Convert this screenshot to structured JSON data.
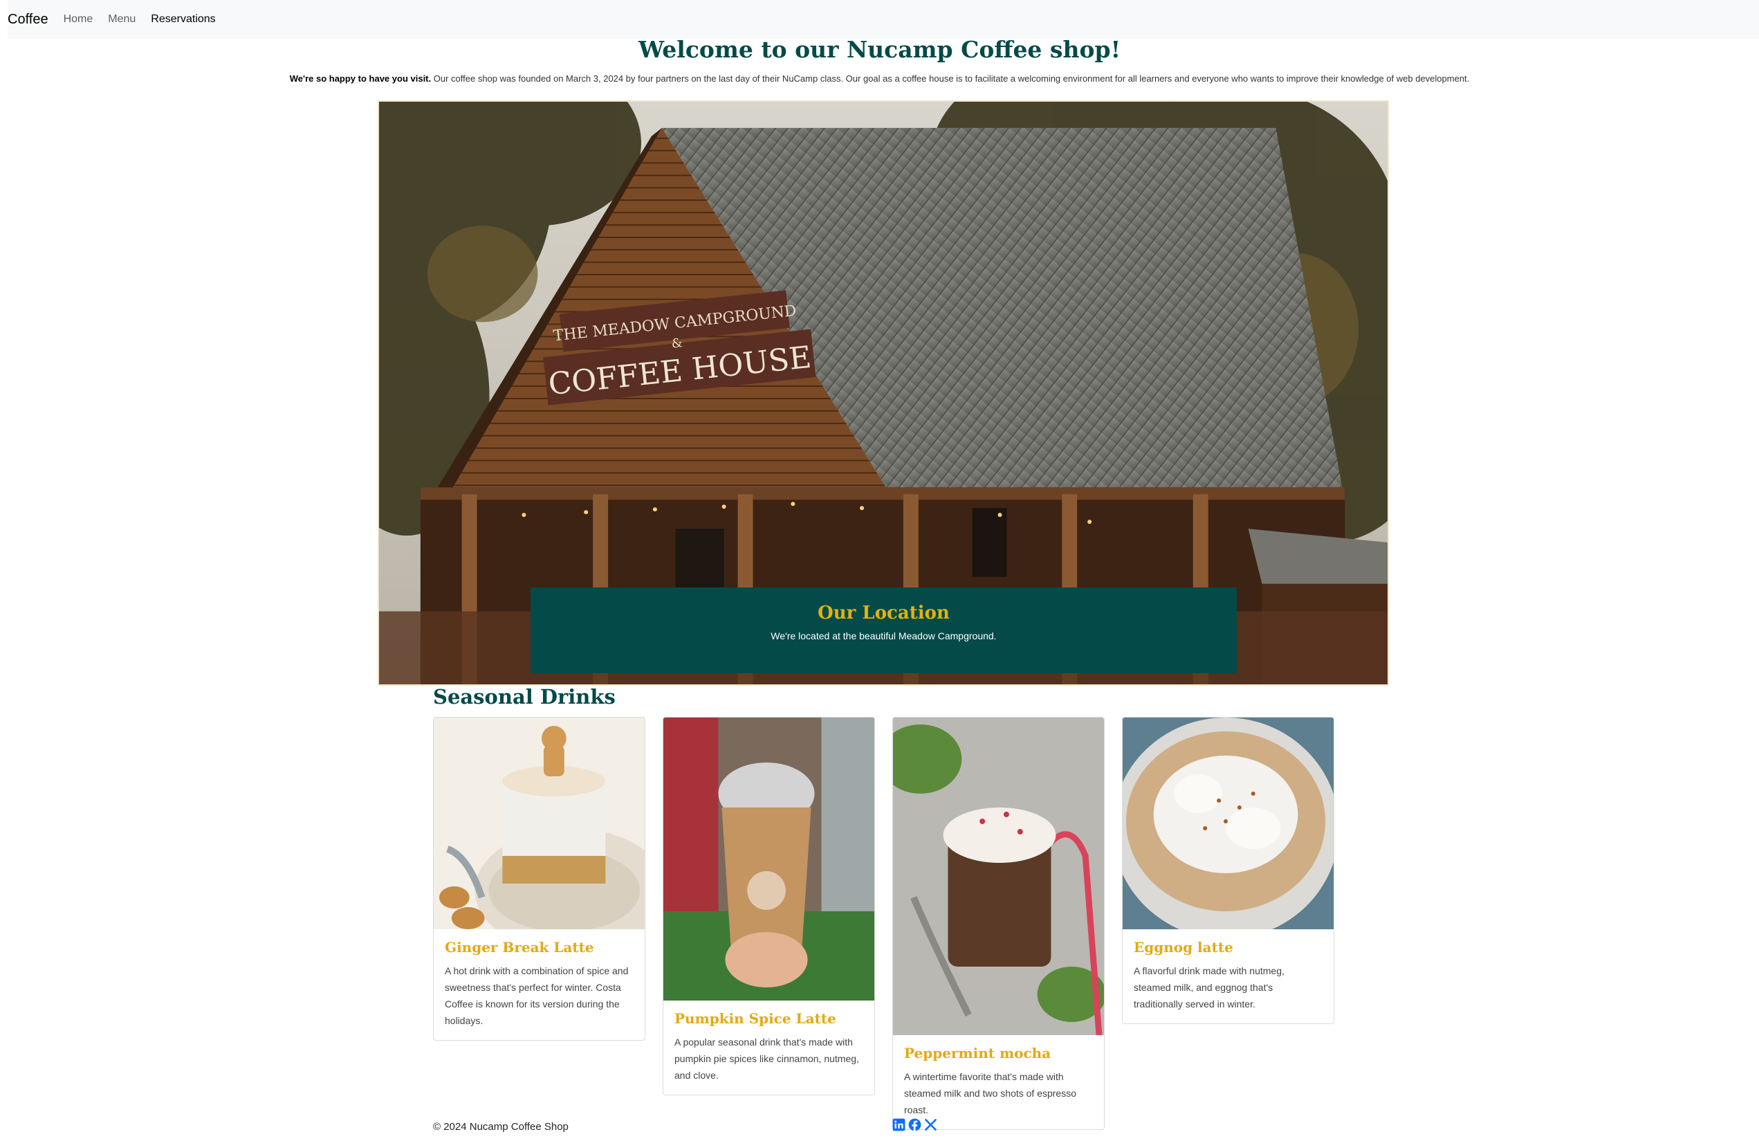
{
  "nav": {
    "brand": "Coffee",
    "links": [
      {
        "label": "Home",
        "active": false
      },
      {
        "label": "Menu",
        "active": false
      },
      {
        "label": "Reservations",
        "active": true
      }
    ]
  },
  "header": {
    "title": "Welcome to our Nucamp Coffee shop!",
    "intro_bold": "We're so happy to have you visit.",
    "intro_text": " Our coffee shop was founded on March 3, 2024 by four partners on the last day of their NuCamp class. Our goal as a coffee house is to facilitate a welcoming environment for all learners and everyone who wants to improve their knowledge of web development."
  },
  "hero": {
    "sign_line1": "THE MEADOW CAMPGROUND",
    "sign_line2": "&",
    "sign_line3": "COFFEE HOUSE",
    "caption_title": "Our Location",
    "caption_text": "We're located at the beautiful Meadow Campground."
  },
  "seasonal": {
    "title": "Seasonal Drinks",
    "cards": [
      {
        "title": "Ginger Break Latte",
        "text": "A hot drink with a combination of spice and sweetness that's perfect for winter. Costa Coffee is known for its version during the holidays."
      },
      {
        "title": "Pumpkin Spice Latte",
        "text": "A popular seasonal drink that's made with pumpkin pie spices like cinnamon, nutmeg, and clove."
      },
      {
        "title": "Peppermint mocha",
        "text": "A wintertime favorite that's made with steamed milk and two shots of espresso roast."
      },
      {
        "title": "Eggnog latte",
        "text": "A flavorful drink made with nutmeg, steamed milk, and eggnog that's traditionally served in winter."
      }
    ]
  },
  "footer": {
    "copyright": "© 2024 Nucamp Coffee Shop",
    "social_icons": [
      "linkedin-icon",
      "facebook-icon",
      "x-icon"
    ]
  },
  "colors": {
    "brand_teal": "#044a49",
    "accent_gold": "#e5a910",
    "navbar_bg": "#f8f9fa"
  }
}
